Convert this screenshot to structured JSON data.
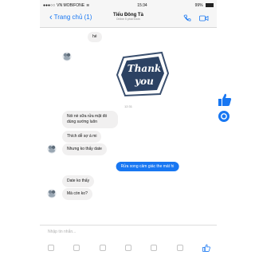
{
  "status_bar": {
    "carrier": "VN MOBIFONE",
    "time": "15:34",
    "battery": "99%",
    "battery_level": 0.99
  },
  "nav": {
    "back_label": "Trang chủ (1)",
    "contact_name": "Tiểu Đông Tà",
    "contact_status": "Online 5 phút trước"
  },
  "messages": {
    "partial_top": "hé",
    "timestamp": "12:31",
    "msg1": "Nói nè sữa rửa mặt đó dùng sướng luôn",
    "msg2": "Thích dễ sợ á mi",
    "msg3": "Nhưng ko thấy date",
    "out1": "Rửa xong cảm giác the mát hi",
    "msg4": "Date ko thấy",
    "msg5": "Mà còn ko?"
  },
  "composer": {
    "placeholder": "Nhập tin nhắn..."
  },
  "colors": {
    "accent": "#1877f2",
    "bubble_in": "#f1f0f0"
  }
}
